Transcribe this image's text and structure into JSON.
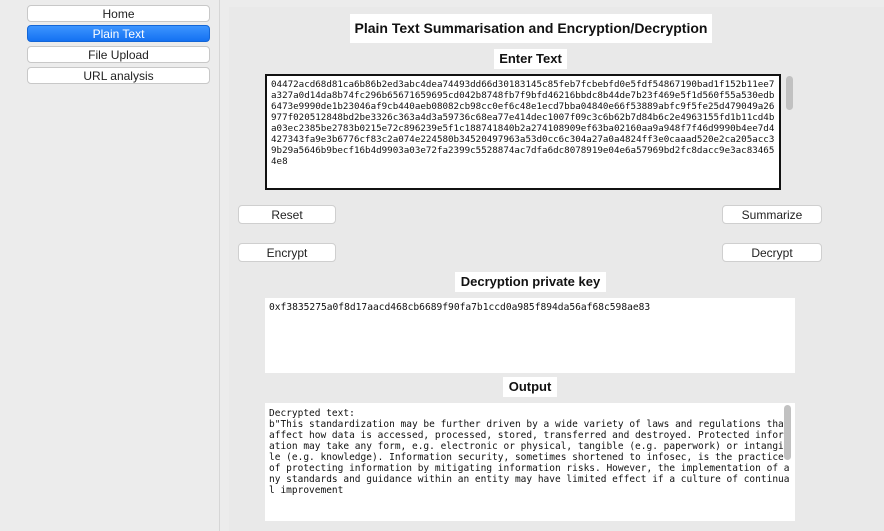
{
  "sidebar": {
    "items": [
      {
        "label": "Home",
        "active": false
      },
      {
        "label": "Plain Text",
        "active": true
      },
      {
        "label": "File Upload",
        "active": false
      },
      {
        "label": "URL analysis",
        "active": false
      }
    ]
  },
  "main": {
    "title": "Plain Text Summarisation and Encryption/Decryption",
    "enter_text_label": "Enter Text",
    "input_text": "04472acd68d81ca6b86b2ed3abc4dea74493dd66d30183145c85feb7fcbebfd0e5fdf54867190bad1f152b11ee7a327a0d14da8b74fc296b65671659695cd042b8748fb7f9bfd46216bbdc8b44de7b23f469e5f1d560f55a530edb6473e9990de1b23046af9cb440aeb08082cb98cc0ef6c48e1ecd7bba04840e66f53889abfc9f5fe25d479049a26977f020512848bd2be3326c363a4d3a59736c68ea77e414dec1007f09c3c6b62b7d84b6c2e4963155fd1b11cd4ba03ec2385be2783b0215e72c896239e5f1c188741840b2a274108909ef63ba02160aa9a948f7f46d9990b4ee7d4427343fa9e3b6776cf83c2a074e224580b34520497963a53d0cc6c304a27a0a4824ff3e0caaad520e2ca205acc39b29a5646b9becf16b4d9903a03e72fa2399c5528874ac7dfa6dc8078919e04e6a57969bd2fc8dacc9e3ac834654e8",
    "buttons": {
      "reset": "Reset",
      "summarize": "Summarize",
      "encrypt": "Encrypt",
      "decrypt": "Decrypt"
    },
    "key_label": "Decryption private key",
    "private_key": "0xf3835275a0f8d17aacd468cb6689f90fa7b1ccd0a985f894da56af68c598ae83",
    "output_label": "Output",
    "output_text": "Decrypted text:\nb\"This standardization may be further driven by a wide variety of laws and regulations that affect how data is accessed, processed, stored, transferred and destroyed. Protected information may take any form, e.g. electronic or physical, tangible (e.g. paperwork) or intangible (e.g. knowledge). Information security, sometimes shortened to infosec, is the practice of protecting information by mitigating information risks. However, the implementation of any standards and guidance within an entity may have limited effect if a culture of continual improvement"
  }
}
